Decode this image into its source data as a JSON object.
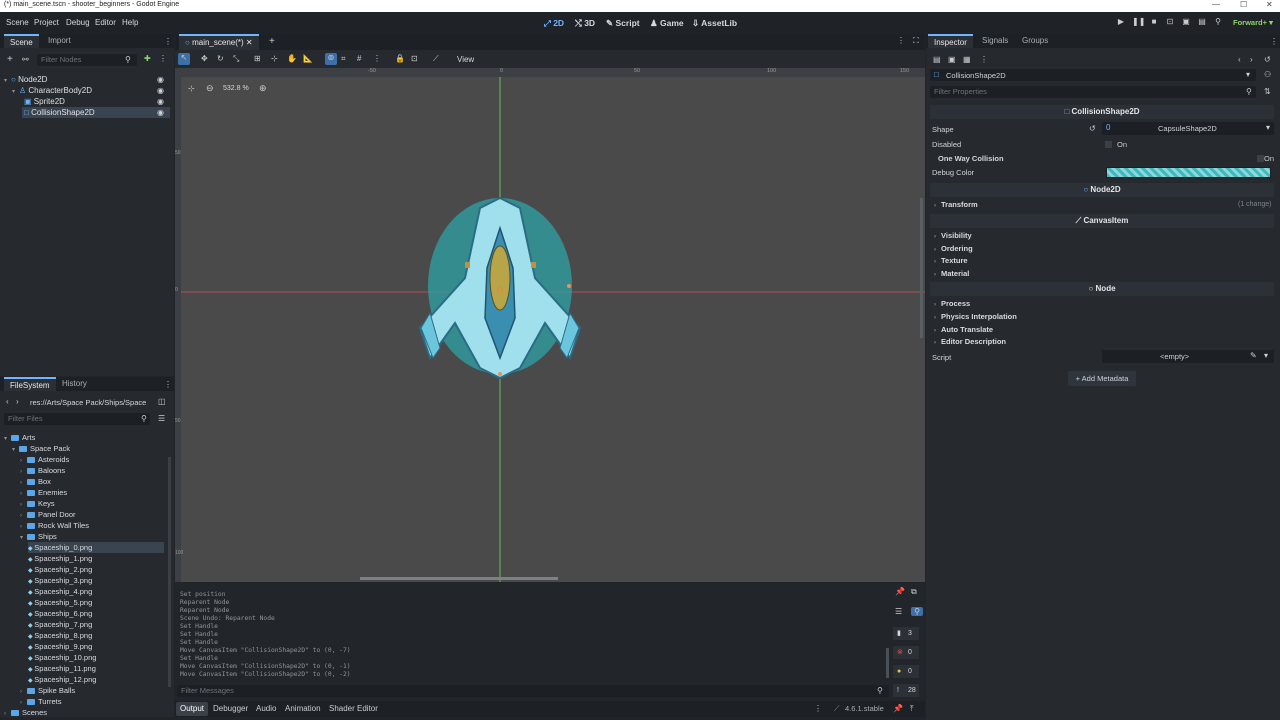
{
  "window": {
    "title": "(*) main_scene.tscn - shooter_beginners - Godot Engine"
  },
  "menu": [
    "Scene",
    "Project",
    "Debug",
    "Editor",
    "Help"
  ],
  "main_screens": {
    "2d": "2D",
    "3d": "3D",
    "script": "Script",
    "game": "Game",
    "assetlib": "AssetLib"
  },
  "renderer": "Forward+",
  "scene_dock": {
    "tabs": [
      "Scene",
      "Import"
    ],
    "filter_placeholder": "Filter Nodes",
    "nodes": [
      "Node2D",
      "CharacterBody2D",
      "Sprite2D",
      "CollisionShape2D"
    ]
  },
  "filesystem_dock": {
    "tabs": [
      "FileSystem",
      "History"
    ],
    "path": "res://Arts/Space Pack/Ships/Space",
    "filter_placeholder": "Filter Files",
    "items": [
      {
        "label": "Arts",
        "level": 1,
        "type": "folder",
        "open": true
      },
      {
        "label": "Space Pack",
        "level": 2,
        "type": "folder",
        "open": true
      },
      {
        "label": "Asteroids",
        "level": 3,
        "type": "folder"
      },
      {
        "label": "Baloons",
        "level": 3,
        "type": "folder"
      },
      {
        "label": "Box",
        "level": 3,
        "type": "folder"
      },
      {
        "label": "Enemies",
        "level": 3,
        "type": "folder"
      },
      {
        "label": "Keys",
        "level": 3,
        "type": "folder"
      },
      {
        "label": "Panel Door",
        "level": 3,
        "type": "folder"
      },
      {
        "label": "Rock Wall Tiles",
        "level": 3,
        "type": "folder"
      },
      {
        "label": "Ships",
        "level": 3,
        "type": "folder",
        "open": true
      },
      {
        "label": "Spaceship_0.png",
        "level": 4,
        "type": "file",
        "selected": true
      },
      {
        "label": "Spaceship_1.png",
        "level": 4,
        "type": "file"
      },
      {
        "label": "Spaceship_2.png",
        "level": 4,
        "type": "file"
      },
      {
        "label": "Spaceship_3.png",
        "level": 4,
        "type": "file"
      },
      {
        "label": "Spaceship_4.png",
        "level": 4,
        "type": "file"
      },
      {
        "label": "Spaceship_5.png",
        "level": 4,
        "type": "file"
      },
      {
        "label": "Spaceship_6.png",
        "level": 4,
        "type": "file"
      },
      {
        "label": "Spaceship_7.png",
        "level": 4,
        "type": "file"
      },
      {
        "label": "Spaceship_8.png",
        "level": 4,
        "type": "file"
      },
      {
        "label": "Spaceship_9.png",
        "level": 4,
        "type": "file"
      },
      {
        "label": "Spaceship_10.png",
        "level": 4,
        "type": "file"
      },
      {
        "label": "Spaceship_11.png",
        "level": 4,
        "type": "file"
      },
      {
        "label": "Spaceship_12.png",
        "level": 4,
        "type": "file"
      },
      {
        "label": "Spike Balls",
        "level": 3,
        "type": "folder"
      },
      {
        "label": "Turrets",
        "level": 3,
        "type": "folder"
      },
      {
        "label": "Scenes",
        "level": 1,
        "type": "folder"
      }
    ]
  },
  "editor": {
    "scene_tab": "main_scene(*)",
    "view_menu": "View",
    "zoom": "532.8 %",
    "ruler": [
      "-50",
      "0",
      "50",
      "100",
      "150"
    ],
    "ruler_v": [
      "50",
      "0",
      "50",
      "100"
    ]
  },
  "output": {
    "lines": [
      "Set position",
      "Reparent Node",
      "Reparent Node",
      "Scene Undo: Reparent Node",
      "Set Handle",
      "Set Handle",
      "Set Handle",
      "Move CanvasItem \"CollisionShape2D\" to (0, -7)",
      "Set Handle",
      "Move CanvasItem \"CollisionShape2D\" to (0, -1)",
      "Move CanvasItem \"CollisionShape2D\" to (0, -2)"
    ],
    "filter_placeholder": "Filter Messages",
    "counts": {
      "log": "3",
      "errors": "0",
      "warnings": "0",
      "messages": "28"
    }
  },
  "bottom_tabs": [
    "Output",
    "Debugger",
    "Audio",
    "Animation",
    "Shader Editor"
  ],
  "version": "4.6.1.stable",
  "inspector": {
    "tabs": [
      "Inspector",
      "Signals",
      "Groups"
    ],
    "object": "CollisionShape2D",
    "filter_placeholder": "Filter Properties",
    "section_collision": "CollisionShape2D",
    "shape_label": "Shape",
    "shape_value": "CapsuleShape2D",
    "shape_id": "0",
    "disabled_label": "Disabled",
    "disabled_value": "On",
    "oneway_label": "One Way Collision",
    "oneway_value": "On",
    "debug_color_label": "Debug Color",
    "section_node2d": "Node2D",
    "transform": "Transform",
    "transform_changes": "(1 change)",
    "section_canvasitem": "CanvasItem",
    "canvas_groups": [
      "Visibility",
      "Ordering",
      "Texture",
      "Material"
    ],
    "section_node": "Node",
    "node_groups": [
      "Process",
      "Physics Interpolation",
      "Auto Translate",
      "Editor Description"
    ],
    "script_label": "Script",
    "script_value": "<empty>",
    "add_metadata": "Add Metadata"
  },
  "colors": {
    "accent": "#6fb6ff",
    "shape": "#2ea3a6",
    "debug_color": "#3fb8bf"
  }
}
